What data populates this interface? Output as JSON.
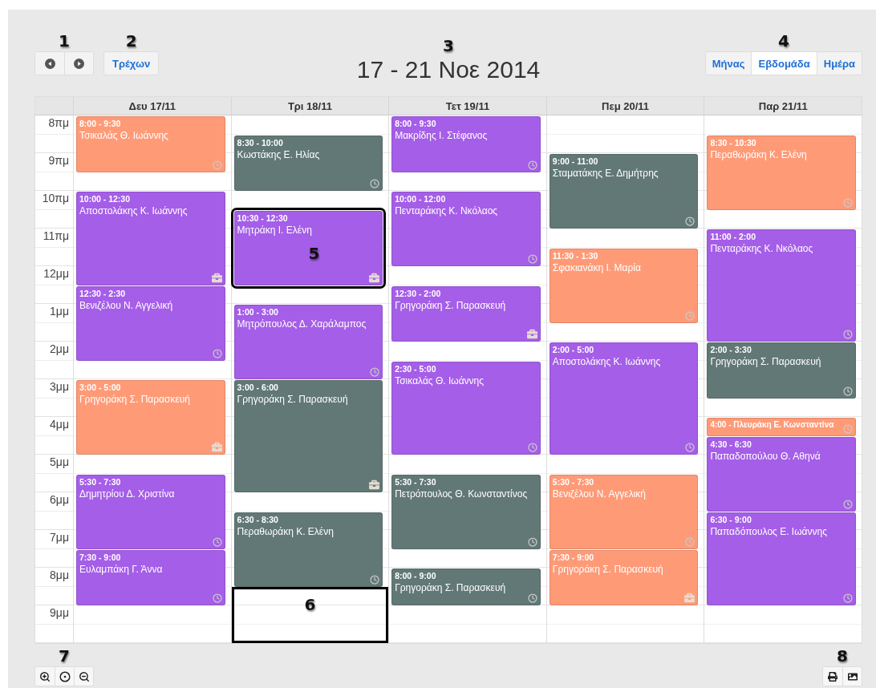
{
  "toolbar": {
    "nav_marker": "1",
    "today_marker": "2",
    "title_marker": "3",
    "views_marker": "4",
    "today_button": "Τρέχων",
    "title": "17 - 21 Νοε 2014",
    "views": [
      {
        "label": "Μήνας",
        "selected": false
      },
      {
        "label": "Εβδομάδα",
        "selected": true
      },
      {
        "label": "Ημέρα",
        "selected": false
      }
    ]
  },
  "hours": [
    "8πμ",
    "9πμ",
    "10πμ",
    "11πμ",
    "12μμ",
    "1μμ",
    "2μμ",
    "3μμ",
    "4μμ",
    "5μμ",
    "6μμ",
    "7μμ",
    "8μμ",
    "9μμ"
  ],
  "days": [
    {
      "label": "Δευ 17/11",
      "events": [
        {
          "kind": "clock",
          "time": "8:00 - 9:30",
          "name": "Τσικαλάς Θ. Ιωάννης",
          "color": "#ff9a77"
        },
        {
          "kind": "briefcase",
          "time": "10:00 - 12:30",
          "name": "Αποστολάκης Κ. Ιωάννης",
          "color": "#a55ee8"
        },
        {
          "kind": "clock",
          "time": "12:30 - 2:30",
          "name": "Βενιζέλου Ν. Αγγελική",
          "color": "#a55ee8"
        },
        {
          "kind": "briefcase",
          "time": "3:00 - 5:00",
          "name": "Γρηγοράκη Σ. Παρασκευή",
          "color": "#ff9a77"
        },
        {
          "kind": "clock",
          "time": "5:30 - 7:30",
          "name": "Δημητρίου Δ. Χριστίνα",
          "color": "#a55ee8"
        },
        {
          "kind": "clock",
          "time": "7:30 - 9:00",
          "name": "Ευλαμπάκη Γ. Άννα",
          "color": "#a55ee8"
        }
      ]
    },
    {
      "label": "Τρι 18/11",
      "marked_slot": {
        "marker": "6"
      },
      "events": [
        {
          "kind": "clock",
          "time": "8:30 - 10:00",
          "name": "Κωστάκης Ε. Ηλίας",
          "color": "#617876"
        },
        {
          "kind": "briefcase",
          "time": "10:30 - 12:30",
          "name": "Μητράκη Ι. Ελένη",
          "color": "#a55ee8",
          "marker": "5"
        },
        {
          "kind": "clock",
          "time": "1:00 - 3:00",
          "name": "Μητρόπουλος Δ. Χαράλαμπος",
          "color": "#a55ee8"
        },
        {
          "kind": "briefcase",
          "time": "3:00 - 6:00",
          "name": "Γρηγοράκη Σ. Παρασκευή",
          "color": "#617876"
        },
        {
          "kind": "clock",
          "time": "6:30 - 8:30",
          "name": "Περαθωράκη Κ. Ελένη",
          "color": "#617876"
        }
      ]
    },
    {
      "label": "Τετ 19/11",
      "events": [
        {
          "kind": "clock",
          "time": "8:00 - 9:30",
          "name": "Μακρίδης Ι. Στέφανος",
          "color": "#a55ee8"
        },
        {
          "kind": "clock",
          "time": "10:00 - 12:00",
          "name": "Πενταράκης Κ. Νκόλαος",
          "color": "#a55ee8"
        },
        {
          "kind": "briefcase",
          "time": "12:30 - 2:00",
          "name": "Γρηγοράκη Σ. Παρασκευή",
          "color": "#a55ee8"
        },
        {
          "kind": "clock",
          "time": "2:30 - 5:00",
          "name": "Τσικαλάς Θ. Ιωάννης",
          "color": "#a55ee8"
        },
        {
          "kind": "clock",
          "time": "5:30 - 7:30",
          "name": "Πετρόπουλος Θ. Κωνσταντίνος",
          "color": "#617876"
        },
        {
          "kind": "clock",
          "time": "8:00 - 9:00",
          "name": "Γρηγοράκη Σ. Παρασκευή",
          "color": "#617876"
        }
      ]
    },
    {
      "label": "Πεμ 20/11",
      "events": [
        {
          "kind": "clock",
          "time": "9:00 - 11:00",
          "name": "Σταματάκης Ε. Δημήτρης",
          "color": "#617876"
        },
        {
          "kind": "clock",
          "time": "11:30 - 1:30",
          "name": "Σφακιανάκη Ι. Μαρία",
          "color": "#ff9a77"
        },
        {
          "kind": "clock",
          "time": "2:00 - 5:00",
          "name": "Αποστολάκης Κ. Ιωάννης",
          "color": "#a55ee8"
        },
        {
          "kind": "clock",
          "time": "5:30 - 7:30",
          "name": "Βενιζέλου Ν. Αγγελική",
          "color": "#ff9a77"
        },
        {
          "kind": "briefcase",
          "time": "7:30 - 9:00",
          "name": "Γρηγοράκη Σ. Παρασκευή",
          "color": "#ff9a77"
        }
      ]
    },
    {
      "label": "Παρ 21/11",
      "events": [
        {
          "kind": "clock",
          "time": "8:30 - 10:30",
          "name": "Περαθωράκη Κ. Ελένη",
          "color": "#ff9a77"
        },
        {
          "kind": "clock",
          "time": "11:00 - 2:00",
          "name": "Πενταράκης Κ. Νκόλαος",
          "color": "#a55ee8"
        },
        {
          "kind": "clock",
          "time": "2:00 - 3:30",
          "name": "Γρηγοράκη Σ. Παρασκευή",
          "color": "#617876"
        },
        {
          "kind": "brief",
          "text": "4:00 - Πλευράκη Ε. Κωνσταντίνα",
          "color": "#ff9a77"
        },
        {
          "kind": "clock",
          "time": "4:30 - 6:30",
          "name": "Παπαδοπούλου Θ. Αθηνά",
          "color": "#a55ee8"
        },
        {
          "kind": "clock",
          "time": "6:30 - 9:00",
          "name": "Παπαδόπουλος Ε. Ιωάννης",
          "color": "#a55ee8"
        }
      ]
    }
  ],
  "footer": {
    "zoom_marker": "7",
    "export_marker": "8"
  }
}
